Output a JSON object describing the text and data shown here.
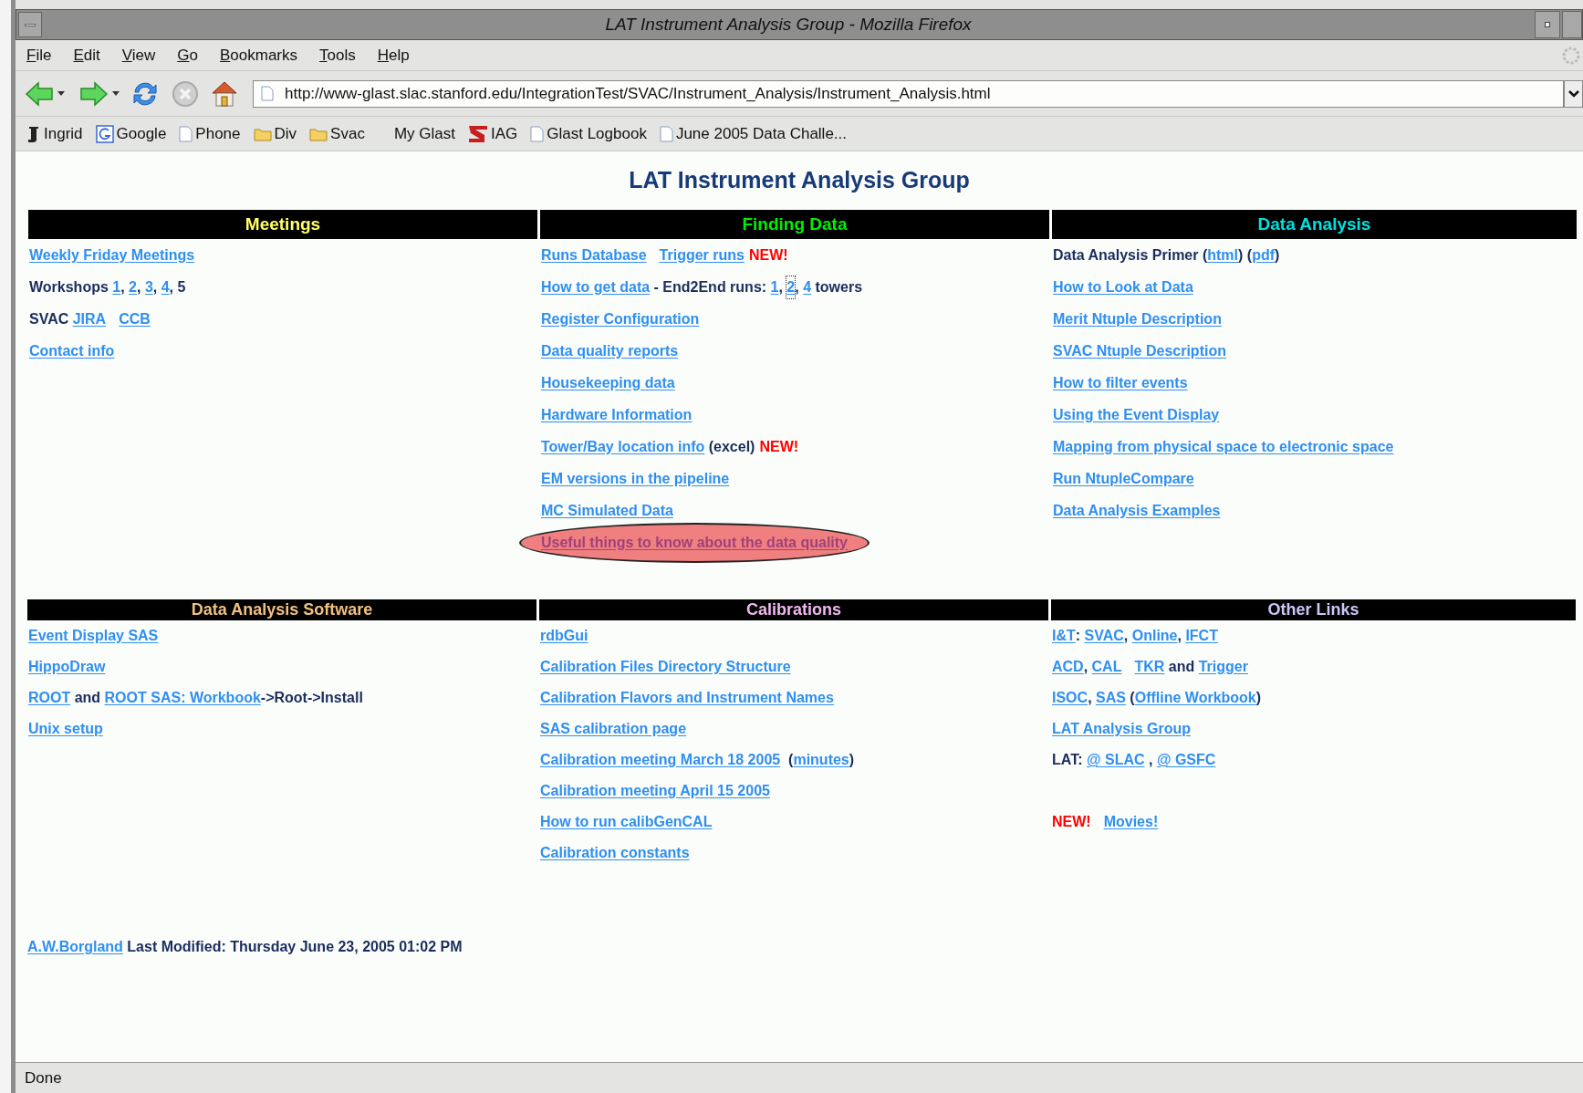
{
  "window": {
    "title": "LAT Instrument Analysis Group - Mozilla Firefox"
  },
  "menu": [
    "File",
    "Edit",
    "View",
    "Go",
    "Bookmarks",
    "Tools",
    "Help"
  ],
  "toolbar": {
    "url": "http://www-glast.slac.stanford.edu/IntegrationTest/SVAC/Instrument_Analysis/Instrument_Analysis.html"
  },
  "bookmarks": [
    {
      "label": "Ingrid",
      "kind": "person"
    },
    {
      "label": "Google",
      "kind": "google"
    },
    {
      "label": "Phone",
      "kind": "page"
    },
    {
      "label": "Div",
      "kind": "folder"
    },
    {
      "label": "Svac",
      "kind": "folder"
    },
    {
      "label": "My Glast",
      "kind": "none"
    },
    {
      "label": "IAG",
      "kind": "slac"
    },
    {
      "label": "Glast Logbook",
      "kind": "page"
    },
    {
      "label": "June 2005 Data Challe...",
      "kind": "page"
    }
  ],
  "page": {
    "title": "LAT Instrument Analysis Group",
    "top_sections": [
      {
        "title": "Meetings",
        "color": "#ffff66",
        "lines": [
          {
            "segments": [
              {
                "kind": "link",
                "text": "Weekly Friday Meetings"
              }
            ]
          },
          {
            "segments": [
              {
                "kind": "text",
                "text": "Workshops "
              },
              {
                "kind": "link",
                "text": "1"
              },
              {
                "kind": "text",
                "text": ", "
              },
              {
                "kind": "link",
                "text": "2"
              },
              {
                "kind": "text",
                "text": ", "
              },
              {
                "kind": "link",
                "text": "3"
              },
              {
                "kind": "text",
                "text": ", "
              },
              {
                "kind": "link",
                "text": "4"
              },
              {
                "kind": "text",
                "text": ", 5"
              }
            ]
          },
          {
            "segments": [
              {
                "kind": "text",
                "text": "SVAC "
              },
              {
                "kind": "link",
                "text": "JIRA"
              },
              {
                "kind": "spaced-link",
                "text": "CCB"
              }
            ]
          },
          {
            "segments": [
              {
                "kind": "link",
                "text": "Contact info"
              }
            ]
          }
        ]
      },
      {
        "title": "Finding Data",
        "color": "#00ee00",
        "lines": [
          {
            "segments": [
              {
                "kind": "link",
                "text": "Runs Database"
              },
              {
                "kind": "spaced-link",
                "text": "Trigger runs"
              },
              {
                "kind": "new",
                "text": "NEW!"
              }
            ]
          },
          {
            "segments": [
              {
                "kind": "link",
                "text": "How to get data"
              },
              {
                "kind": "text",
                "text": " - End2End runs: "
              },
              {
                "kind": "link",
                "text": "1"
              },
              {
                "kind": "text",
                "text": ", "
              },
              {
                "kind": "focused-link",
                "text": "2"
              },
              {
                "kind": "text",
                "text": ", "
              },
              {
                "kind": "link",
                "text": "4"
              },
              {
                "kind": "text",
                "text": " towers"
              }
            ]
          },
          {
            "segments": [
              {
                "kind": "link",
                "text": "Register Configuration"
              }
            ]
          },
          {
            "segments": [
              {
                "kind": "link",
                "text": "Data quality reports"
              }
            ]
          },
          {
            "segments": [
              {
                "kind": "link",
                "text": "Housekeeping data"
              }
            ]
          },
          {
            "segments": [
              {
                "kind": "link",
                "text": "Hardware Information"
              }
            ]
          },
          {
            "segments": [
              {
                "kind": "link",
                "text": "Tower/Bay location info"
              },
              {
                "kind": "text",
                "text": " (excel)"
              },
              {
                "kind": "new",
                "text": "NEW!"
              }
            ]
          },
          {
            "segments": [
              {
                "kind": "link",
                "text": "EM versions in the pipeline"
              }
            ]
          },
          {
            "segments": [
              {
                "kind": "link",
                "text": "MC Simulated Data"
              }
            ]
          },
          {
            "segments": [
              {
                "kind": "circled-link",
                "text": "Useful things to know about the data quality"
              }
            ]
          }
        ]
      },
      {
        "title": "Data Analysis",
        "color": "#00e0e0",
        "lines": [
          {
            "segments": [
              {
                "kind": "text",
                "text": "Data Analysis Primer ("
              },
              {
                "kind": "link",
                "text": "html"
              },
              {
                "kind": "text",
                "text": ") ("
              },
              {
                "kind": "link",
                "text": "pdf"
              },
              {
                "kind": "text",
                "text": ")"
              }
            ]
          },
          {
            "segments": [
              {
                "kind": "link",
                "text": "How to Look at Data"
              }
            ]
          },
          {
            "segments": [
              {
                "kind": "link",
                "text": "Merit Ntuple Description"
              }
            ]
          },
          {
            "segments": [
              {
                "kind": "link",
                "text": "SVAC Ntuple Description"
              }
            ]
          },
          {
            "segments": [
              {
                "kind": "link",
                "text": "How to filter events"
              }
            ]
          },
          {
            "segments": [
              {
                "kind": "link",
                "text": "Using the Event Display"
              }
            ]
          },
          {
            "segments": [
              {
                "kind": "link",
                "text": "Mapping from physical space to electronic space"
              }
            ]
          },
          {
            "segments": [
              {
                "kind": "link",
                "text": "Run NtupleCompare"
              }
            ]
          },
          {
            "segments": [
              {
                "kind": "link",
                "text": "Data Analysis Examples"
              }
            ]
          }
        ]
      }
    ],
    "bottom_sections": [
      {
        "title": "Data Analysis Software",
        "color": "#f0c080",
        "lines": [
          {
            "segments": [
              {
                "kind": "link",
                "text": "Event Display SAS"
              }
            ]
          },
          {
            "segments": [
              {
                "kind": "link",
                "text": "HippoDraw"
              }
            ]
          },
          {
            "segments": [
              {
                "kind": "link",
                "text": "ROOT"
              },
              {
                "kind": "text",
                "text": " and "
              },
              {
                "kind": "link",
                "text": "ROOT SAS: Workbook"
              },
              {
                "kind": "text",
                "text": "->Root->Install"
              }
            ]
          },
          {
            "segments": [
              {
                "kind": "link",
                "text": "Unix setup"
              }
            ]
          }
        ]
      },
      {
        "title": "Calibrations",
        "color": "#f0b8f0",
        "lines": [
          {
            "segments": [
              {
                "kind": "link",
                "text": "rdbGui"
              }
            ]
          },
          {
            "segments": [
              {
                "kind": "link",
                "text": "Calibration Files Directory Structure"
              }
            ]
          },
          {
            "segments": [
              {
                "kind": "link",
                "text": "Calibration Flavors and Instrument Names"
              }
            ]
          },
          {
            "segments": [
              {
                "kind": "link",
                "text": "SAS calibration page"
              }
            ]
          },
          {
            "segments": [
              {
                "kind": "link",
                "text": "Calibration meeting March 18 2005"
              },
              {
                "kind": "text",
                "text": "  ("
              },
              {
                "kind": "link",
                "text": "minutes"
              },
              {
                "kind": "text",
                "text": ")"
              }
            ]
          },
          {
            "segments": [
              {
                "kind": "link",
                "text": "Calibration meeting April 15 2005"
              }
            ]
          },
          {
            "segments": [
              {
                "kind": "link",
                "text": "How to run calibGenCAL"
              }
            ]
          },
          {
            "segments": [
              {
                "kind": "link",
                "text": "Calibration constants"
              }
            ]
          }
        ]
      },
      {
        "title": "Other Links",
        "color": "#c8c8f8",
        "lines": [
          {
            "segments": [
              {
                "kind": "link",
                "text": "I&T"
              },
              {
                "kind": "text",
                "text": ": "
              },
              {
                "kind": "link",
                "text": "SVAC"
              },
              {
                "kind": "text",
                "text": ", "
              },
              {
                "kind": "link",
                "text": "Online"
              },
              {
                "kind": "text",
                "text": ", "
              },
              {
                "kind": "link",
                "text": "IFCT"
              }
            ]
          },
          {
            "segments": [
              {
                "kind": "link",
                "text": "ACD"
              },
              {
                "kind": "text",
                "text": ", "
              },
              {
                "kind": "link",
                "text": "CAL"
              },
              {
                "kind": "spaced-link",
                "text": "TKR"
              },
              {
                "kind": "text",
                "text": " and "
              },
              {
                "kind": "link",
                "text": "Trigger"
              }
            ]
          },
          {
            "segments": [
              {
                "kind": "link",
                "text": "ISOC"
              },
              {
                "kind": "text",
                "text": ", "
              },
              {
                "kind": "link",
                "text": "SAS"
              },
              {
                "kind": "text",
                "text": " ("
              },
              {
                "kind": "link",
                "text": "Offline Workbook"
              },
              {
                "kind": "text",
                "text": ")"
              }
            ]
          },
          {
            "segments": [
              {
                "kind": "link",
                "text": "LAT Analysis Group"
              }
            ]
          },
          {
            "segments": [
              {
                "kind": "text",
                "text": "LAT: "
              },
              {
                "kind": "link",
                "text": "@ SLAC"
              },
              {
                "kind": "text",
                "text": " , "
              },
              {
                "kind": "link",
                "text": "@ GSFC"
              }
            ]
          },
          {
            "gap_before": true,
            "segments": [
              {
                "kind": "new",
                "text": "NEW!"
              },
              {
                "kind": "spaced-link",
                "text": "Movies!"
              }
            ]
          }
        ]
      }
    ],
    "footer": [
      {
        "kind": "link",
        "text": "A.W.Borgland"
      },
      {
        "kind": "text",
        "text": " Last Modified: Thursday June 23, 2005 01:02 PM"
      }
    ]
  },
  "status_bar": "Done"
}
